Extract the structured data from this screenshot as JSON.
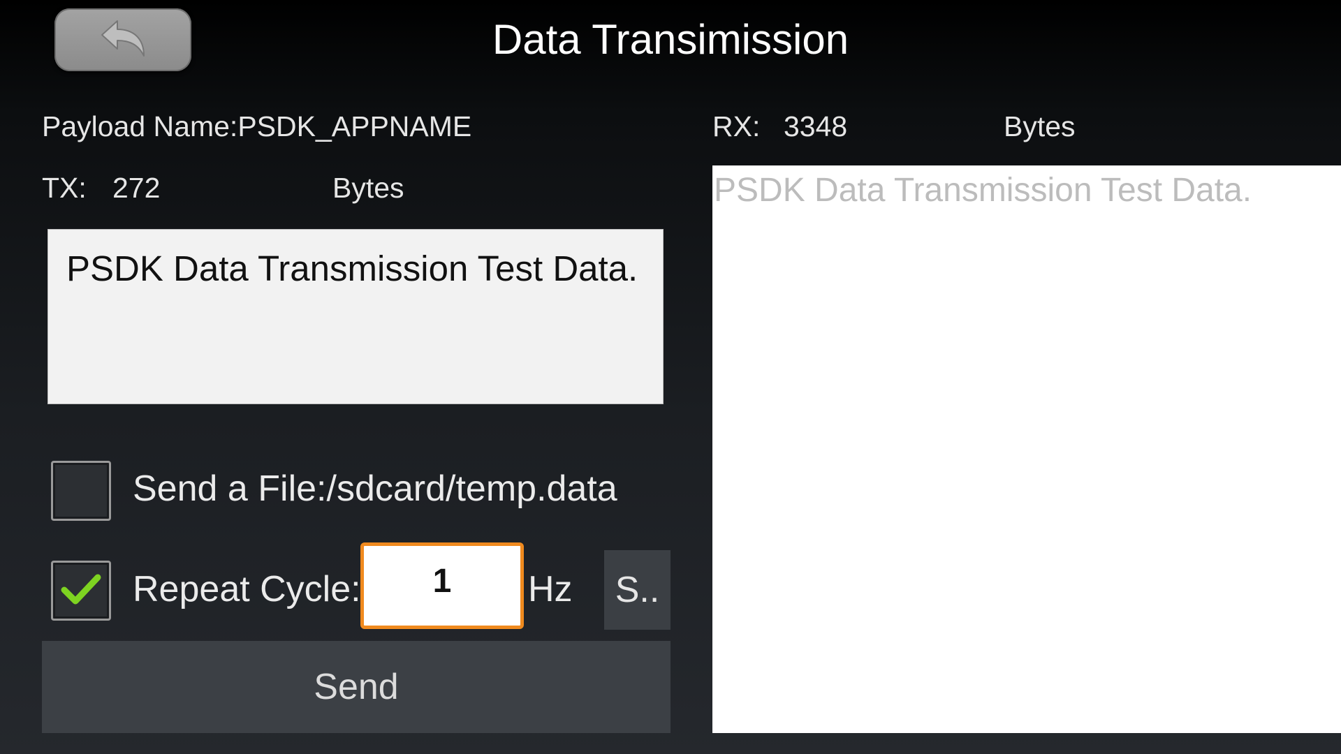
{
  "header": {
    "title": "Data Transimission",
    "back_icon": "back-arrow-icon"
  },
  "payload": {
    "name_label": "Payload Name:PSDK_APPNAME"
  },
  "tx": {
    "label": "TX:",
    "value": "272",
    "unit": "Bytes",
    "text": "PSDK Data Transmission Test Data."
  },
  "rx": {
    "label": "RX:",
    "value": "3348",
    "unit": "Bytes",
    "text": "PSDK Data Transmission Test Data."
  },
  "options": {
    "send_file": {
      "label": "Send a File:/sdcard/temp.data",
      "checked": false
    },
    "repeat": {
      "label": "Repeat Cycle:",
      "checked": true,
      "value": "1",
      "unit": "Hz",
      "action_label": "S.."
    }
  },
  "send_button": {
    "label": "Send"
  },
  "colors": {
    "accent": "#f08a1e",
    "check": "#7ed321"
  }
}
